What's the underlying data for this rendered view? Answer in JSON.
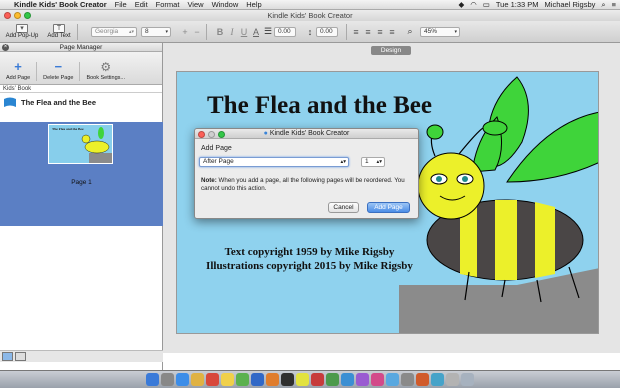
{
  "menubar": {
    "app_name": "Kindle Kids' Book Creator",
    "items": [
      "File",
      "Edit",
      "Format",
      "View",
      "Window",
      "Help"
    ],
    "clock": "Tue 1:33 PM",
    "user": "Michael Rigsby"
  },
  "window": {
    "title": "Kindle Kids' Book Creator"
  },
  "toolbar": {
    "add_popup_label": "Add Pop-Up",
    "add_text_label": "Add Text",
    "font_family": "Georgia",
    "font_size": "8",
    "line_spacing": "0.00",
    "letter_spacing": "0.00",
    "zoom": "45%"
  },
  "page_manager": {
    "title": "Page Manager",
    "add_page_label": "Add Page",
    "delete_page_label": "Delete Page",
    "book_settings_label": "Book Settings...",
    "section_label": "Kids' Book",
    "book_title": "The Flea and the Bee",
    "page_label": "Page 1"
  },
  "canvas": {
    "design_tab": "Design",
    "page_title": "The Flea and the Bee",
    "copyright_line1": "Text copyright 1959 by Mike Rigsby",
    "copyright_line2": "Illustrations copyright 2015 by Mike Rigsby"
  },
  "dialog": {
    "title": "Kindle Kids' Book Creator",
    "label": "Add Page",
    "position_option": "After Page",
    "page_number": "1",
    "note_bold": "Note:",
    "note_text": "When you add a page, all the following pages will be reordered. You cannot undo this action.",
    "cancel_label": "Cancel",
    "add_page_label": "Add Page"
  },
  "colors": {
    "sky": "#8fd2ee",
    "selection": "#5b7fc4",
    "bee_yellow": "#ecf02a",
    "bee_dark": "#4a4646",
    "wing_green": "#3fd43a",
    "ground": "#8b8b8b"
  }
}
